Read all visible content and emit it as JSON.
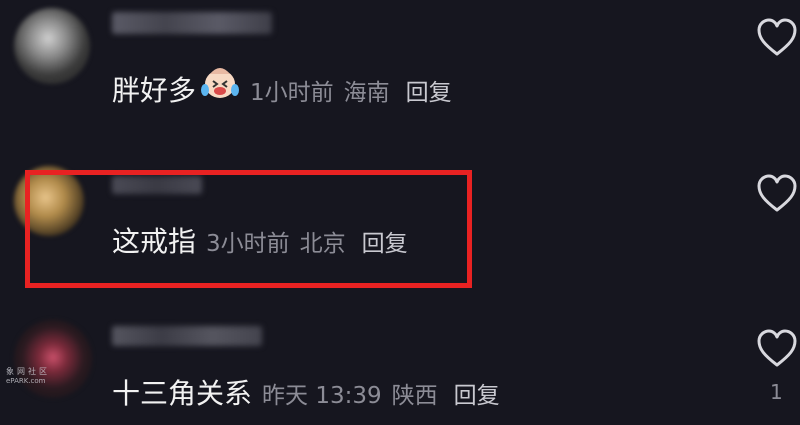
{
  "comments": [
    {
      "text": "胖好多",
      "emoji": "crying-laughing-emoji",
      "time": "1小时前",
      "location": "海南",
      "reply_label": "回复"
    },
    {
      "text": "这戒指",
      "time": "3小时前",
      "location": "北京",
      "reply_label": "回复"
    },
    {
      "text": "十三角关系",
      "time": "昨天 13:39",
      "location": "陕西",
      "reply_label": "回复",
      "like_count": "1"
    }
  ],
  "watermark": {
    "text_cn": "象网社区",
    "text_en": "ePARK.com"
  },
  "colors": {
    "background": "#16161f",
    "highlight": "#e82222",
    "meta": "#8c8c96"
  }
}
